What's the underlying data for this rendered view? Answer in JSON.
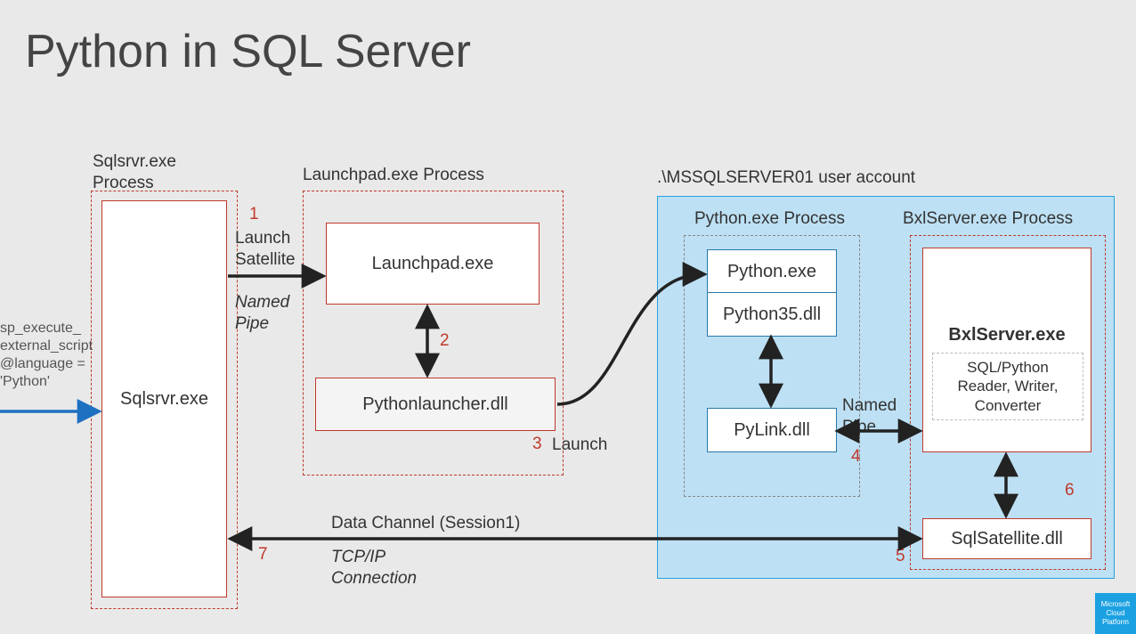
{
  "title": "Python in SQL Server",
  "labels": {
    "sqlsrvr_process": "Sqlsrvr.exe\nProcess",
    "launchpad_process": "Launchpad.exe  Process",
    "user_account": ".\\MSSQLSERVER01  user account",
    "python_process": "Python.exe Process",
    "bxl_process": "BxlServer.exe Process",
    "sp_execute": "sp_execute_\nexternal_script\n@language =\n'Python'",
    "launch_satellite": "Launch\nSatellite",
    "named_pipe_1": "Named\nPipe",
    "launch": "Launch",
    "named_pipe_2": "Named\nPipe",
    "data_channel": "Data Channel (Session1)",
    "tcpip": "TCP/IP\nConnection"
  },
  "boxes": {
    "sqlsrvr": "Sqlsrvr.exe",
    "launchpad": "Launchpad.exe",
    "pythonlauncher": "Pythonlauncher.dll",
    "python_exe": "Python.exe",
    "python35": "Python35.dll",
    "pylink": "PyLink.dll",
    "bxlserver": "BxlServer.exe",
    "bxlserver_sub": "SQL/Python\nReader, Writer,\nConverter",
    "sqlsatellite": "SqlSatellite.dll"
  },
  "steps": {
    "1": "1",
    "2": "2",
    "3": "3",
    "4": "4",
    "5": "5",
    "6": "6",
    "7": "7"
  },
  "footer": "Microsoft\nCloud\nPlatform"
}
